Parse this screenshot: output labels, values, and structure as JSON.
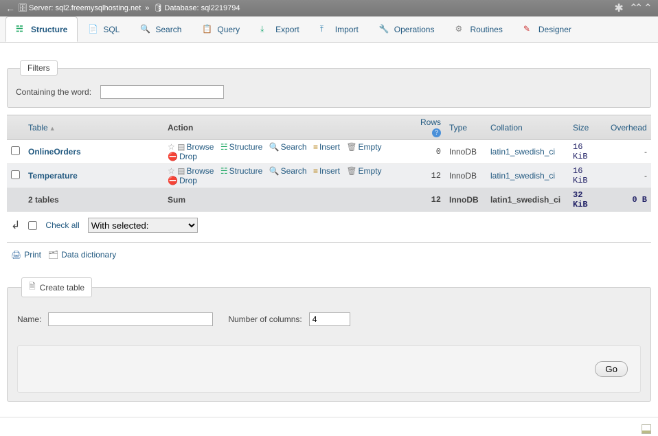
{
  "breadcrumb": {
    "server_label": "Server:",
    "server_value": "sql2.freemysqlhosting.net",
    "sep": "»",
    "db_label": "Database:",
    "db_value": "sql2219794"
  },
  "tabs": [
    {
      "id": "structure",
      "label": "Structure",
      "icon": "i-struct",
      "active": true
    },
    {
      "id": "sql",
      "label": "SQL",
      "icon": "i-sql",
      "active": false
    },
    {
      "id": "search",
      "label": "Search",
      "icon": "i-search",
      "active": false
    },
    {
      "id": "query",
      "label": "Query",
      "icon": "i-query",
      "active": false
    },
    {
      "id": "export",
      "label": "Export",
      "icon": "i-export",
      "active": false
    },
    {
      "id": "import",
      "label": "Import",
      "icon": "i-import",
      "active": false
    },
    {
      "id": "operations",
      "label": "Operations",
      "icon": "i-oper",
      "active": false
    },
    {
      "id": "routines",
      "label": "Routines",
      "icon": "i-rout",
      "active": false
    },
    {
      "id": "designer",
      "label": "Designer",
      "icon": "i-design",
      "active": false
    }
  ],
  "filters": {
    "legend": "Filters",
    "label": "Containing the word:",
    "value": ""
  },
  "table_headers": {
    "table": "Table",
    "action": "Action",
    "rows": "Rows",
    "type": "Type",
    "collation": "Collation",
    "size": "Size",
    "overhead": "Overhead"
  },
  "action_labels": {
    "browse": "Browse",
    "structure": "Structure",
    "search": "Search",
    "insert": "Insert",
    "empty": "Empty",
    "drop": "Drop"
  },
  "tables": [
    {
      "name": "OnlineOrders",
      "rows": "0",
      "type": "InnoDB",
      "collation": "latin1_swedish_ci",
      "size": "16 KiB",
      "overhead": "-",
      "alt": false
    },
    {
      "name": "Temperature",
      "rows": "12",
      "type": "InnoDB",
      "collation": "latin1_swedish_ci",
      "size": "16 KiB",
      "overhead": "-",
      "alt": true
    }
  ],
  "sum": {
    "label": "2 tables",
    "sum_label": "Sum",
    "rows": "12",
    "type": "InnoDB",
    "collation": "latin1_swedish_ci",
    "size": "32 KiB",
    "overhead": "0 B"
  },
  "checkall": {
    "label": "Check all",
    "dropdown": "With selected:"
  },
  "sublinks": {
    "print": "Print",
    "dict": "Data dictionary"
  },
  "create": {
    "legend": "Create table",
    "name_label": "Name:",
    "name_value": "",
    "cols_label": "Number of columns:",
    "cols_value": "4",
    "go": "Go"
  }
}
